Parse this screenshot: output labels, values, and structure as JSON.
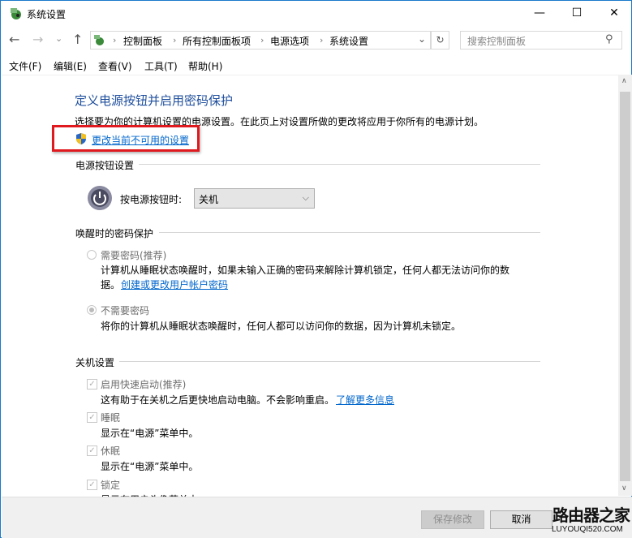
{
  "window": {
    "title": "系统设置",
    "minimize": "—",
    "maximize": "☐",
    "close": "✕"
  },
  "nav": {
    "back": "←",
    "forward": "→",
    "recent": "⌄",
    "up": "↑",
    "breadcrumb": [
      "控制面板",
      "所有控制面板项",
      "电源选项",
      "系统设置"
    ],
    "separator": "›",
    "dropdown": "⌄",
    "refresh": "↻"
  },
  "search": {
    "placeholder": "搜索控制面板",
    "icon": "⚲"
  },
  "menu": [
    "文件(F)",
    "编辑(E)",
    "查看(V)",
    "工具(T)",
    "帮助(H)"
  ],
  "main": {
    "heading": "定义电源按钮并启用密码保护",
    "description": "选择要为你的计算机设置的电源设置。在此页上对设置所做的更改将应用于你所有的电源计划。",
    "change_link": "更改当前不可用的设置",
    "power_section": "电源按钮设置",
    "power_label": "按电源按钮时:",
    "power_value": "关机",
    "wake_section": "唤醒时的密码保护",
    "require_pw": {
      "label": "需要密码(推荐)",
      "desc1": "计算机从睡眠状态唤醒时，如果未输入正确的密码来解除计算机锁定，任何人都无法访问你的数",
      "desc2": "据。",
      "link": "创建或更改用户帐户密码"
    },
    "no_pw": {
      "label": "不需要密码",
      "desc": "将你的计算机从睡眠状态唤醒时，任何人都可以访问你的数据，因为计算机未锁定。"
    },
    "shutdown_section": "关机设置",
    "fast_startup": {
      "label": "启用快速启动(推荐)",
      "desc": "这有助于在关机之后更快地启动电脑。不会影响重启。",
      "link": "了解更多信息"
    },
    "sleep": {
      "label": "睡眠",
      "desc": "显示在“电源”菜单中。"
    },
    "hibernate": {
      "label": "休眠",
      "desc": "显示在“电源”菜单中。"
    },
    "lock": {
      "label": "锁定",
      "desc": "显示在用户头像菜单中。"
    }
  },
  "footer": {
    "save": "保存修改",
    "cancel": "取消"
  },
  "watermark": {
    "title": "路由器之家",
    "url": "LUYOUQI520.COM"
  }
}
